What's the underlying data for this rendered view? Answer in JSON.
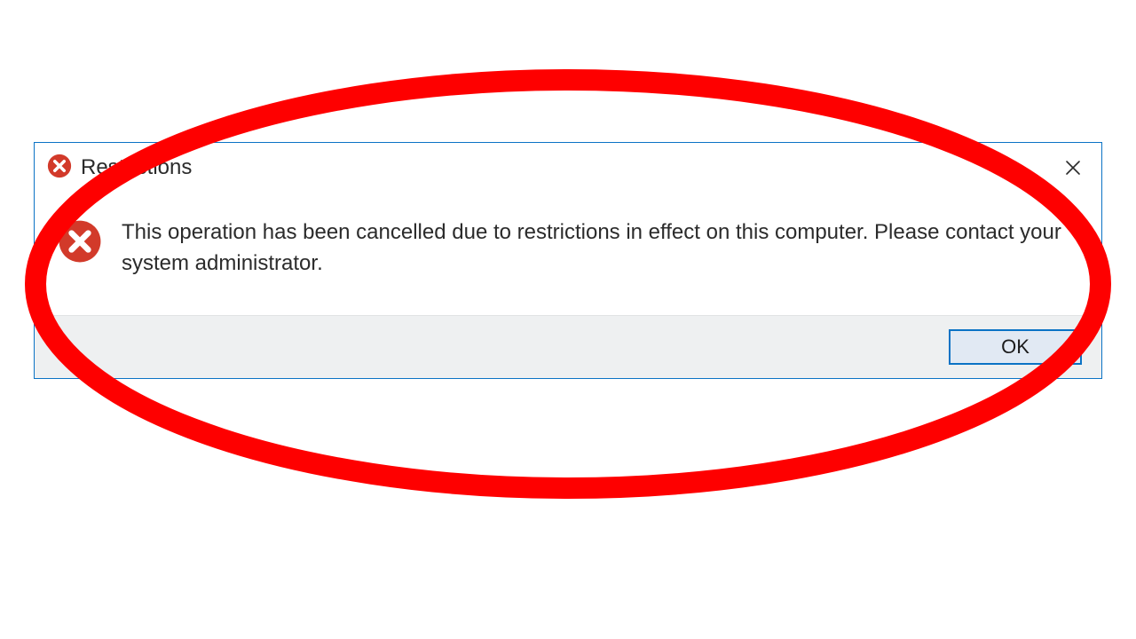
{
  "dialog": {
    "title": "Restrictions",
    "message": "This operation has been cancelled due to restrictions in effect on this computer. Please contact your system administrator.",
    "ok_label": "OK"
  },
  "colors": {
    "error_icon": "#d23a2a",
    "dialog_border": "#0b73c5",
    "annotation": "#fe0000"
  }
}
